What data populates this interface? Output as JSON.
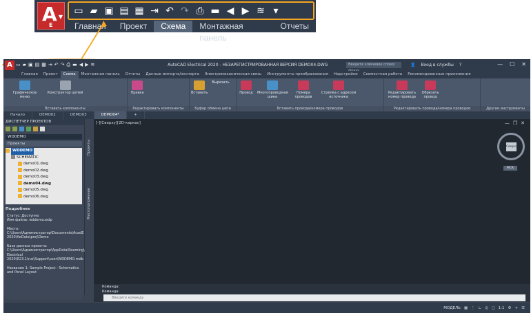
{
  "zoom": {
    "logo_letter": "A",
    "logo_sub": "E",
    "qat_icons": [
      "new-icon",
      "open-icon",
      "save-icon",
      "save-as-icon",
      "publish-icon",
      "export-icon",
      "undo-icon",
      "redo-icon",
      "plot-icon",
      "folder-icon",
      "back-icon",
      "forward-icon",
      "web-icon",
      "customize-icon"
    ],
    "tabs": [
      "Главная",
      "Проект",
      "Схема",
      "Монтажная панель",
      "Отчеты"
    ],
    "active_tab": "Схема"
  },
  "app": {
    "title": "AutoCAD Electrical 2020 - НЕЗАРЕГИСТРИРОВАННАЯ ВЕРСИЯ  DEMO04.DWG",
    "search_placeholder": "Введите ключевое слово/фразу",
    "signin": "Вход в службы",
    "ribbon_tabs": [
      "Главная",
      "Проект",
      "Схема",
      "Монтажная панель",
      "Отчеты",
      "Данные импорта/экспорта",
      "Электромеханическая связь",
      "Инструменты преобразования",
      "Надстройки",
      "Совместная работа",
      "Рекомендованные приложения"
    ],
    "active_ribbon_tab": "Схема",
    "panels": [
      {
        "title": "Вставить компоненты",
        "buttons": [
          "Графическое меню",
          "Конструктор цепей"
        ]
      },
      {
        "title": "Редактировать компоненты",
        "buttons": [
          "Правка"
        ]
      },
      {
        "title": "Буфер обмена цепи",
        "buttons": [
          "Вставить",
          "Вырезать"
        ]
      },
      {
        "title": "Вставить провода/номера проводов",
        "buttons": [
          "Провод",
          "Многопроводная шина",
          "Номера проводов",
          "Стрелка с адресом источника"
        ]
      },
      {
        "title": "Редактировать провода/номера проводов",
        "buttons": [
          "Редактировать номер провода",
          "Обрезать провод"
        ]
      },
      {
        "title": "Другие инструменты",
        "buttons": []
      }
    ],
    "doc_tabs": [
      "Начало",
      "DEMO02",
      "DEMO03",
      "DEMO04*"
    ],
    "active_doc": "DEMO04*",
    "pm": {
      "header": "ДИСПЕТЧЕР ПРОЕКТОВ",
      "project_select": "WDDEMO",
      "projects_label": "Проекты",
      "tree_root": "WDDEMO",
      "tree_folder": "SCHEMATIC",
      "files": [
        "demo01.dwg",
        "demo02.dwg",
        "demo03.dwg",
        "demo04.dwg",
        "demo05.dwg",
        "demo06.dwg"
      ],
      "active_file": "demo04.dwg",
      "details_label": "Подробнее",
      "details": "Статус: Доступно\nИмя файла: wddemo.wdp\n\nМесто: C:\\Users\\Администратор\\Documents\\AcadE 2020\\AeData\\proj\\Demo\n\nБаза данных проекта: C:\\Users\\Администратор\\AppData\\Roaming\\Autodesk\\AutoCAD Electrical 2020\\R23.1\\rus\\Support\\user\\WDDEMO.mdb\n\nНазвание 1: Sample Project - Schematics and Panel Layout"
    },
    "vtabs": [
      "Проекты",
      "Местоположение"
    ],
    "viewport_label": "[-][Сверху][2D-каркас]",
    "viewcube_face": "Сверху",
    "wcs": "МСК",
    "cmd_lines": [
      "Команда:",
      "Команда:"
    ],
    "cmd_placeholder": "Введите команду",
    "status_items": [
      "МОДЕЛЬ",
      "1:1"
    ]
  }
}
